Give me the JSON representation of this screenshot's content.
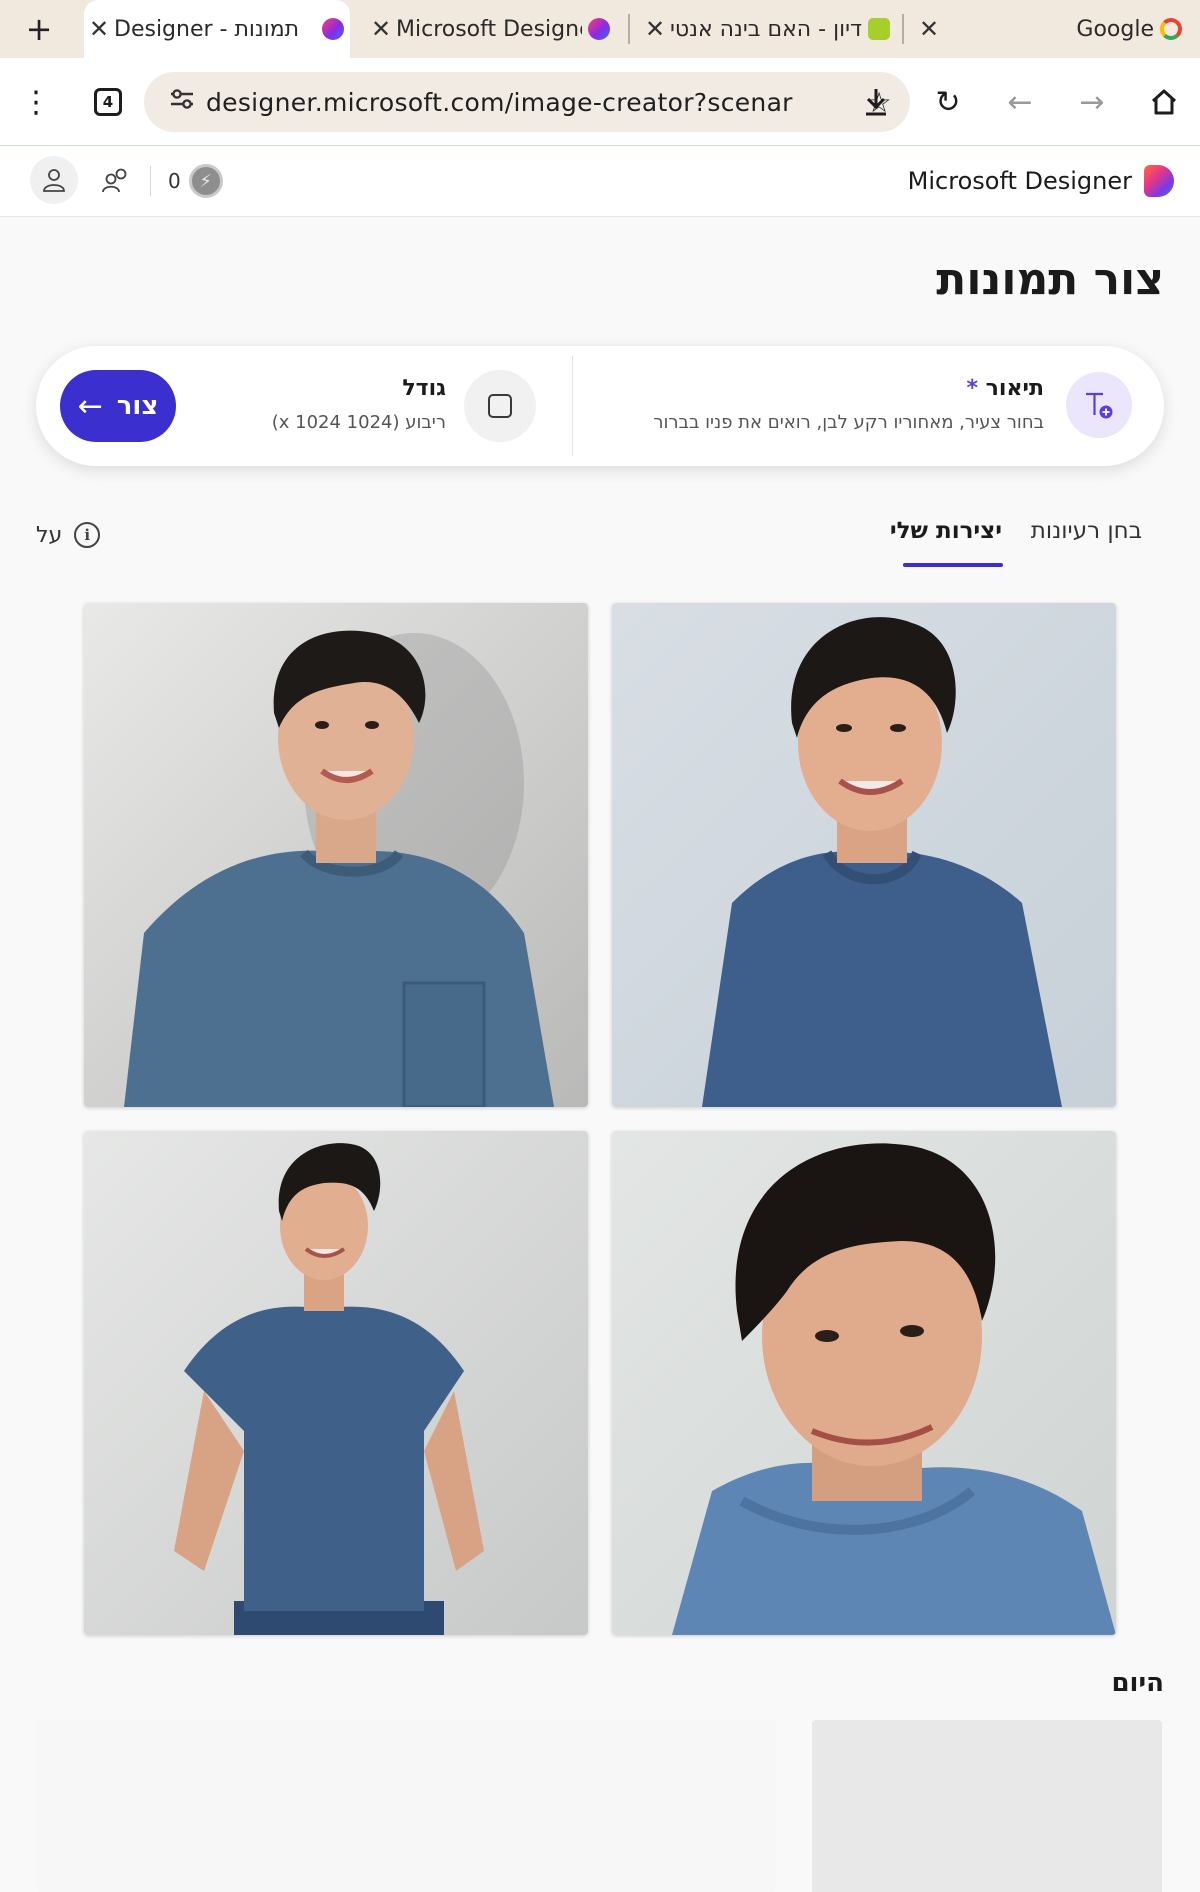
{
  "browser": {
    "tabs": [
      {
        "title": "תמונות - Designer",
        "active": true
      },
      {
        "title": "Microsoft Designer",
        "active": false
      },
      {
        "title": "דיון - האם בינה אנטי",
        "active": false
      }
    ],
    "google_label": "Google",
    "tab_count": "4",
    "url": "designer.microsoft.com/image-creator?scenar"
  },
  "app": {
    "brand": "Microsoft Designer",
    "credits": "0"
  },
  "page": {
    "title": "צור תמונות",
    "prompt": {
      "description_label": "תיאור",
      "required_mark": "*",
      "description_text": "בחור צעיר, מאחוריו רקע לבן, רואים את פניו בברור",
      "size_label": "גודל",
      "size_value": "ריבוע (1024 x 1024)",
      "create_button": "צור"
    },
    "tabs": {
      "ideas": "בחן רעיונות",
      "my_creations": "יצירות שלי"
    },
    "about_label": "על",
    "section_today": "היום"
  },
  "colors": {
    "accent": "#3b2fd0",
    "tab_strip": "#f1e8de",
    "shirt": "#3d5f86"
  },
  "icons": {
    "new_tab": "plus-icon",
    "tab_close": "close-icon",
    "menu": "kebab-menu-icon",
    "site_info": "tune-icon",
    "bookmark": "star-icon",
    "download": "download-icon",
    "reload": "reload-icon",
    "back": "arrow-left-icon",
    "forward": "arrow-right-icon",
    "home": "home-icon",
    "profile": "person-icon",
    "people": "people-icon",
    "coin": "coin-icon",
    "description": "text-add-icon",
    "size": "square-icon",
    "info": "info-icon"
  }
}
